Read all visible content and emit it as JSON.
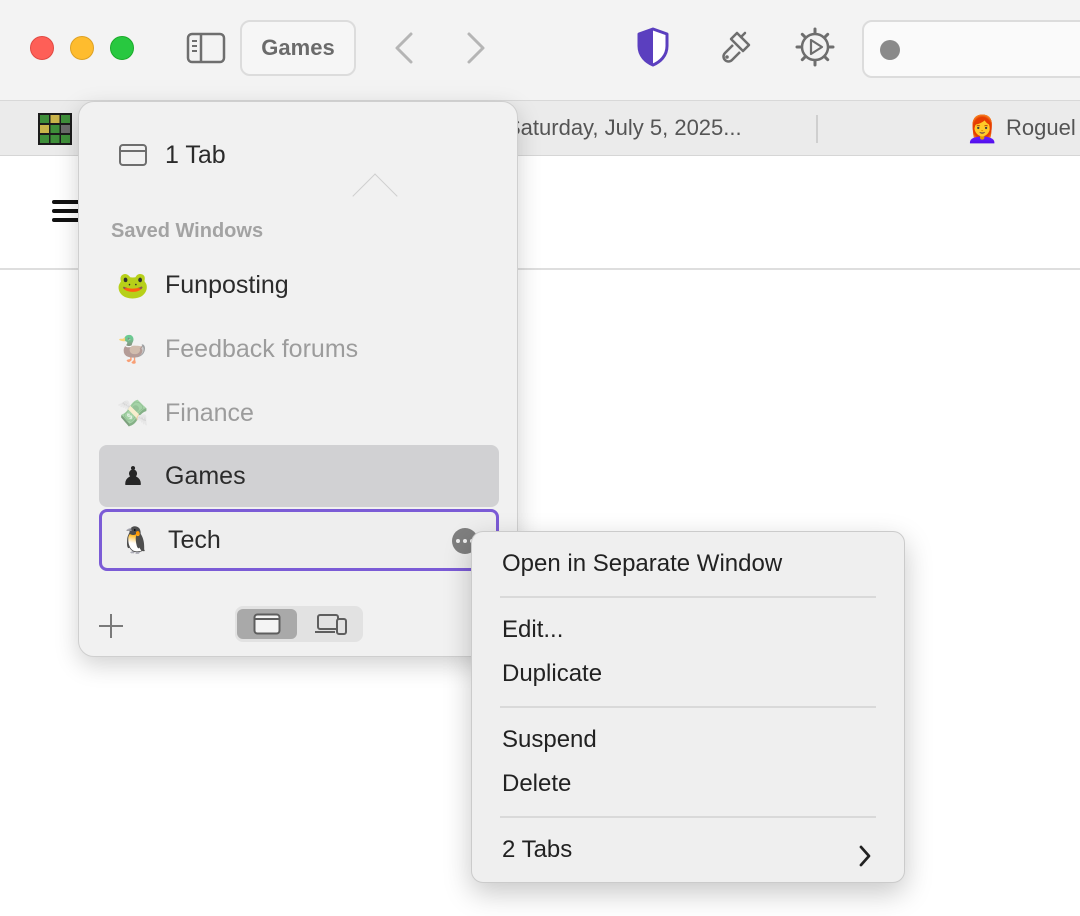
{
  "toolbar": {
    "tab_group_label": "Games",
    "address_value": ""
  },
  "tab_bar": {
    "tabs": [
      {
        "title": "Saturday, July 5, 2025..."
      },
      {
        "title": "Roguel",
        "favicon": "👩‍🦰"
      }
    ]
  },
  "popover": {
    "current_label": "1 Tab",
    "saved_heading": "Saved Windows",
    "saved_windows": [
      {
        "emoji": "🐸",
        "label": "Funposting",
        "state": "normal"
      },
      {
        "emoji": "🦆",
        "label": "Feedback forums",
        "state": "dimmed"
      },
      {
        "emoji": "💸",
        "label": "Finance",
        "state": "dimmed"
      },
      {
        "emoji": "♟",
        "label": "Games",
        "state": "selected"
      },
      {
        "emoji": "🐧",
        "label": "Tech",
        "state": "focused"
      }
    ]
  },
  "context_menu": {
    "items": [
      "Open in Separate Window",
      "Edit...",
      "Duplicate",
      "Suspend",
      "Delete",
      "2 Tabs"
    ]
  },
  "colors": {
    "focus_ring": "#7b5bd6",
    "shield_icon": "#5b3fbf",
    "selected_row": "#d1d1d3"
  }
}
